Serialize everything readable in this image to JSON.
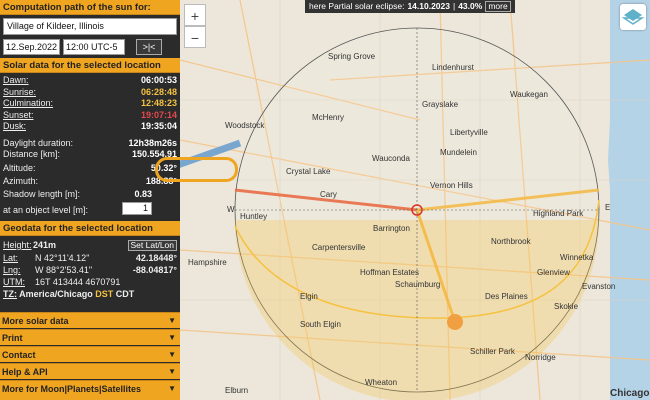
{
  "header": {
    "title": "Computation path of the sun for:"
  },
  "location": {
    "place": "Village of Kildeer, Illinois",
    "date": "12.Sep.2022",
    "time": "12:00 UTC-5",
    "nav_button": ">|<"
  },
  "solar": {
    "section_title": "Solar data for the selected location",
    "rows": [
      {
        "label": "Dawn:",
        "value": "06:00:53"
      },
      {
        "label": "Sunrise:",
        "value": "06:28:48"
      },
      {
        "label": "Culmination:",
        "value": "12:48:23"
      },
      {
        "label": "Sunset:",
        "value": "19:07:14"
      },
      {
        "label": "Dusk:",
        "value": "19:35:04"
      },
      {
        "label": "Daylight duration:",
        "value": "12h38m26s"
      },
      {
        "label": "Distance [km]:",
        "value": "150.554.91"
      },
      {
        "label": "Altitude:",
        "value": "50.32°"
      },
      {
        "label": "Azimuth:",
        "value": "188.88°"
      },
      {
        "label": "Shadow length [m]:",
        "value": "0.83"
      },
      {
        "label": "at an object level [m]:",
        "value": "1"
      }
    ]
  },
  "geo": {
    "section_title": "Geodata for the selected location",
    "height_label": "Height:",
    "height_value": "241m",
    "set_button": "Set Lat/Lon",
    "lat_label": "Lat:",
    "lat_dms": "N 42°11'4.12\"",
    "lat_dec": "42.18448°",
    "lng_label": "Lng:",
    "lng_dms": "W 88°2'53.41\"",
    "lng_dec": "-88.04817°",
    "utm_label": "UTM:",
    "utm_value": "16T 413444 4670791",
    "tz_label": "TZ:",
    "tz_value": "America/Chicago",
    "tz_dst": "DST",
    "tz_abbr": "CDT"
  },
  "menu": [
    {
      "label": "More solar data"
    },
    {
      "label": "Print"
    },
    {
      "label": "Contact"
    },
    {
      "label": "Help & API"
    },
    {
      "label": "More for Moon|Planets|Satellites"
    }
  ],
  "banner": {
    "prefix": "here Partial solar eclipse:",
    "date": "14.10.2023",
    "sep": "|",
    "pct": "43.0%",
    "more": "more"
  },
  "map": {
    "cities": [
      {
        "name": "Spring Grove"
      },
      {
        "name": "Lindenhurst"
      },
      {
        "name": "Grayslake"
      },
      {
        "name": "Waukegan"
      },
      {
        "name": "McHenry"
      },
      {
        "name": "Woodstock"
      },
      {
        "name": "Wauconda"
      },
      {
        "name": "Mundelein"
      },
      {
        "name": "Libertyville"
      },
      {
        "name": "Crystal Lake"
      },
      {
        "name": "Cary"
      },
      {
        "name": "Vernon Hills"
      },
      {
        "name": "Highland Park"
      },
      {
        "name": "Huntley"
      },
      {
        "name": "Barrington"
      },
      {
        "name": "Carpentersville"
      },
      {
        "name": "Northbrook"
      },
      {
        "name": "Winnetka"
      },
      {
        "name": "Hampshire"
      },
      {
        "name": "Hoffman Estates"
      },
      {
        "name": "Schaumburg"
      },
      {
        "name": "Glenview"
      },
      {
        "name": "Des Plaines"
      },
      {
        "name": "Elgin"
      },
      {
        "name": "Skokie"
      },
      {
        "name": "Evanston"
      },
      {
        "name": "South Elgin"
      },
      {
        "name": "Schiller Park"
      },
      {
        "name": "Norridge"
      },
      {
        "name": "Elburn"
      },
      {
        "name": "Wheaton"
      },
      {
        "name": "Chicago"
      }
    ],
    "compass_w": "W",
    "compass_e": "E"
  },
  "colors": {
    "accent": "#f0a521",
    "sidebar_bg": "#2b2b2b",
    "sunrise_line": "#f5b942",
    "sunset_line": "#e8663d",
    "sun": "#f0a040"
  }
}
